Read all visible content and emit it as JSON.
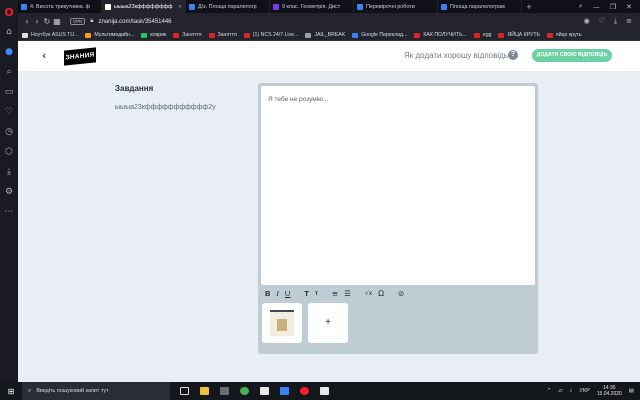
{
  "browser": {
    "tabs": [
      {
        "label": "4. Висота трикутника. ф",
        "fav": "#3b82f6",
        "active": false
      },
      {
        "label": "ыыыа23кфффффффф",
        "fav": "#ffffff",
        "active": true
      },
      {
        "label": "Д/з. Площа паралелогр",
        "fav": "#3b82f6",
        "active": false
      },
      {
        "label": "9 клас. Геометрія. Дист",
        "fav": "#7c3aed",
        "active": false
      },
      {
        "label": "Перевірочні роботи",
        "fav": "#3b82f6",
        "active": false
      },
      {
        "label": "Площа паралелограм",
        "fav": "#3b82f6",
        "active": false
      }
    ],
    "url": "znanija.com/task/35451446",
    "vpn_label": "VPN",
    "bookmarks": [
      {
        "label": "Ноутбук ASUS TU...",
        "color": "#e0e0e0"
      },
      {
        "label": "Мультимедийн...",
        "color": "#f59e0b"
      },
      {
        "label": "коврик",
        "color": "#22c55e"
      },
      {
        "label": "Заняття",
        "color": "#dc2626"
      },
      {
        "label": "Заняття",
        "color": "#dc2626"
      },
      {
        "label": "(1) NCS 24/7 Live...",
        "color": "#dc2626"
      },
      {
        "label": "JAIL_BREAK",
        "color": "#9ca3af"
      },
      {
        "label": "Google Переклад...",
        "color": "#3b82f6"
      },
      {
        "label": "КАК ПОЛУЧИТЬ...",
        "color": "#dc2626"
      },
      {
        "label": "egg",
        "color": "#dc2626"
      },
      {
        "label": "ЯЙЦА КРУТЬ",
        "color": "#dc2626"
      },
      {
        "label": "яйцо круть",
        "color": "#dc2626"
      }
    ]
  },
  "page": {
    "logo_text": "ЗНАНИЯ",
    "how_to_answer": "Як додати хорошу відповідь",
    "help_symbol": "?",
    "add_answer_button": "Додати свою відповідь",
    "task_title": "Завдання",
    "task_text": "ыыыа23кффффффффффф2у",
    "editor_placeholder": "Я тебе не розумію...",
    "toolbar": {
      "bold": "B",
      "italic": "I",
      "underline": "U",
      "text_size_large": "T",
      "text_size_small": "т",
      "ordered_list": "≡",
      "bullet_list": "☰",
      "formula": "√x",
      "omega": "Ω",
      "attach": "⊘"
    },
    "add_image": "+"
  },
  "taskbar": {
    "search_placeholder": "Введіть пошуковий запит тут",
    "language": "УКР",
    "time": "14:36",
    "date": "15.04.2020"
  }
}
